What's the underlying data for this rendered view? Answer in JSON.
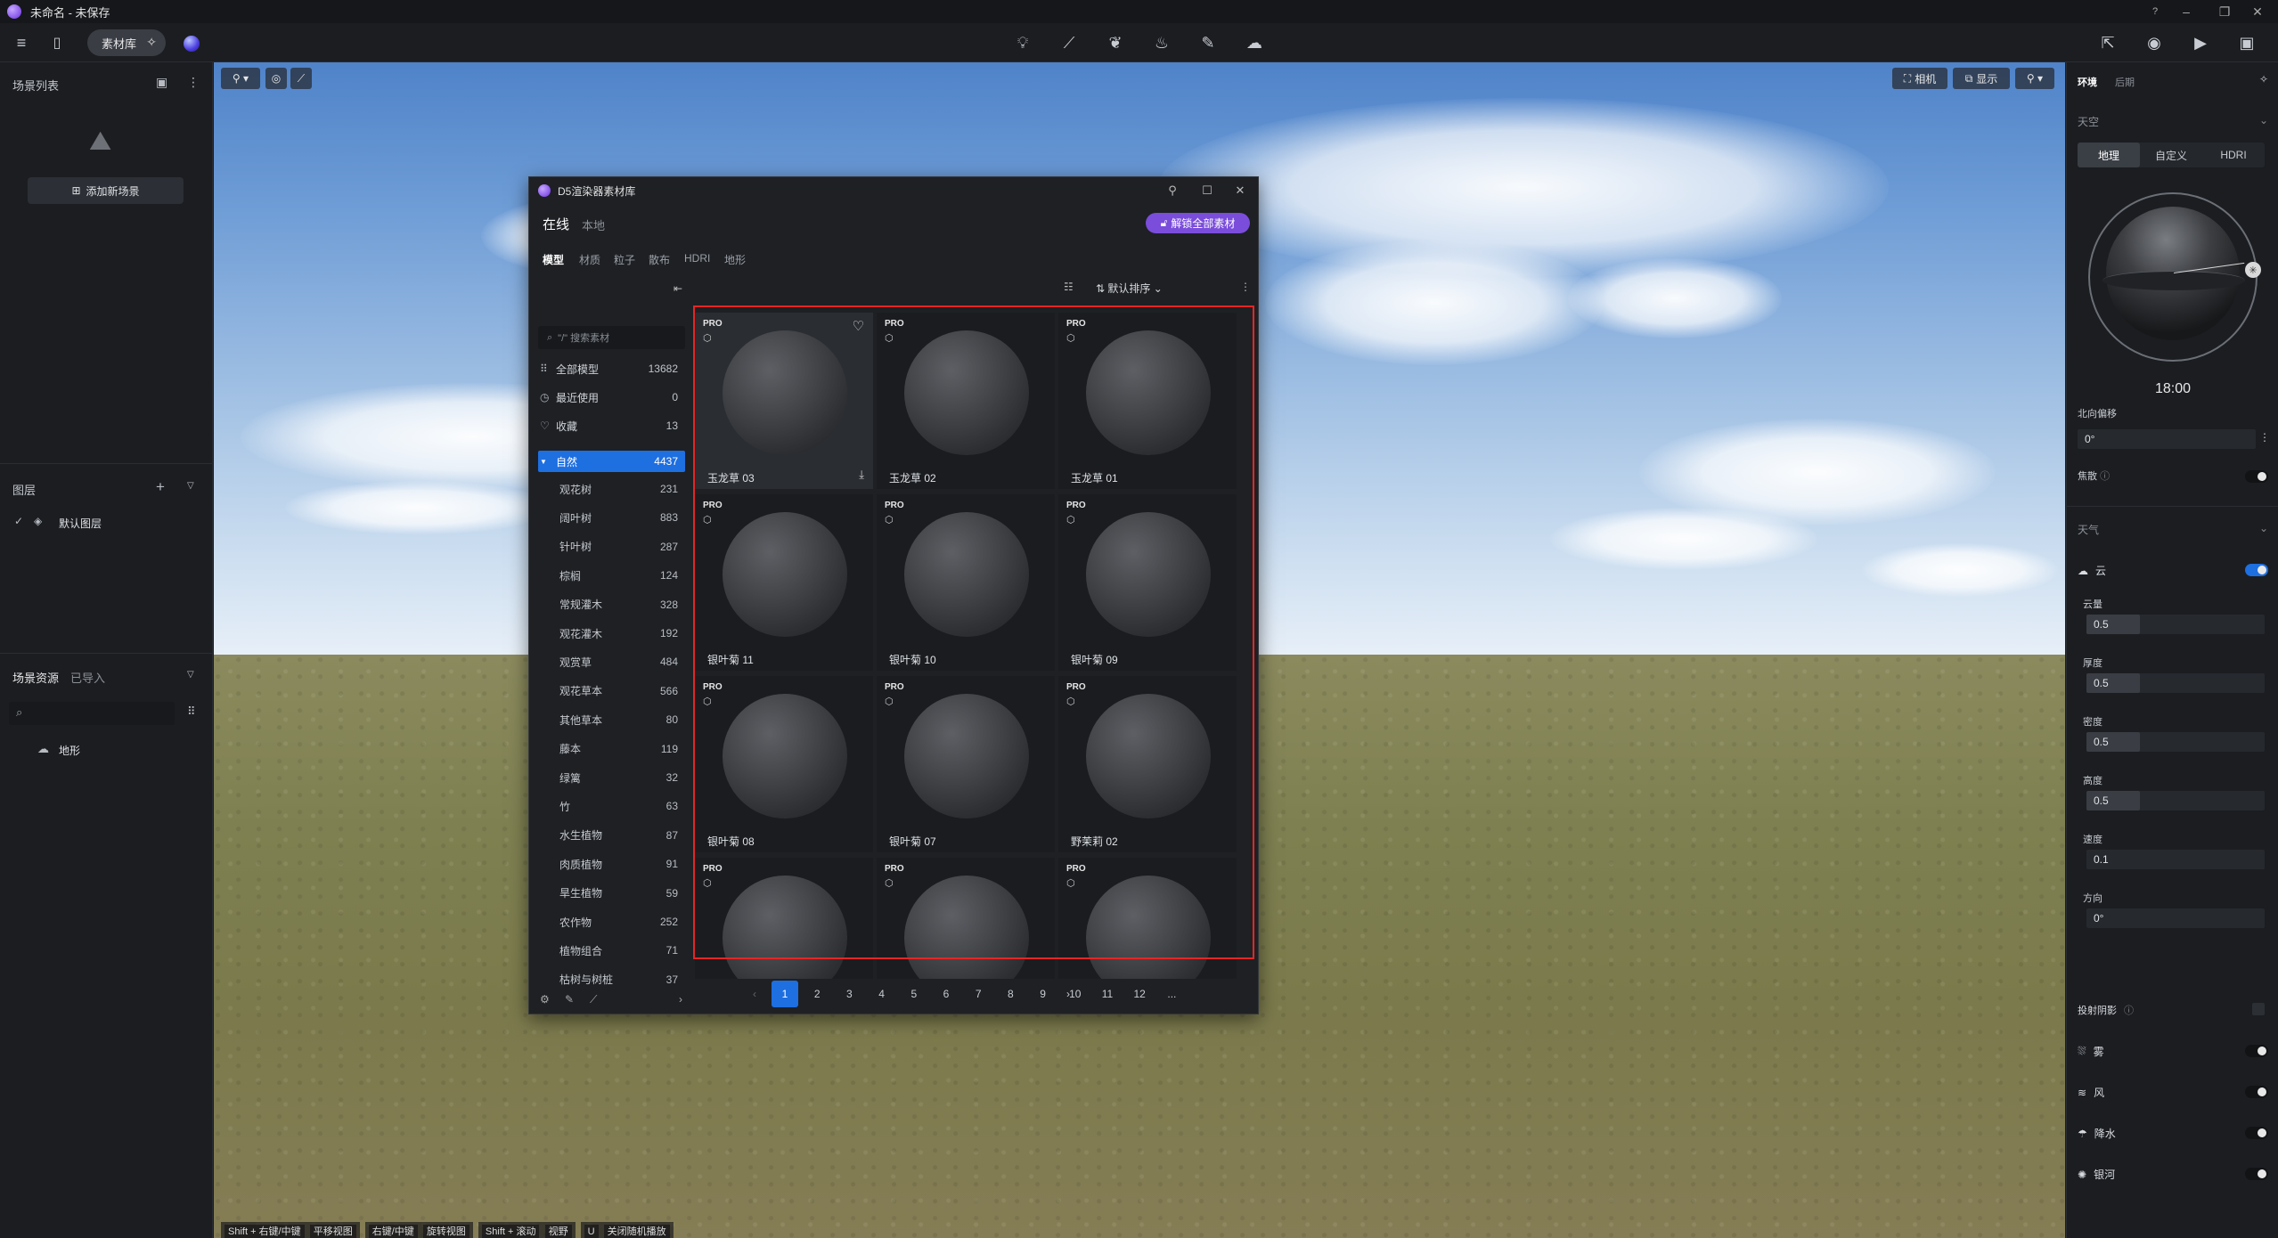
{
  "app": {
    "title": "未命名 - 未保存"
  },
  "toolbar": {
    "library_label": "素材库"
  },
  "left": {
    "scene_list_label": "场景列表",
    "add_scene_label": "添加新场景",
    "layers_label": "图层",
    "default_layer": "默认图层",
    "scene_assets_label": "场景资源",
    "imported_label": "已导入",
    "terrain_label": "地形"
  },
  "viewport": {
    "camera_label": "相机",
    "display_label": "显示",
    "hints": [
      "Shift + 右键/中键",
      "平移视图",
      "右键/中键",
      "旋转视图",
      "Shift + 滚动",
      "视野",
      "U",
      "关闭随机播放"
    ]
  },
  "library": {
    "title": "D5渲染器素材库",
    "online": "在线",
    "local": "本地",
    "unlock": "解锁全部素材",
    "tabs": [
      "模型",
      "材质",
      "粒子",
      "散布",
      "HDRI",
      "地形"
    ],
    "search_placeholder": "\"/\" 搜索素材",
    "sort_label": "默认排序",
    "top_cats": [
      {
        "label": "全部模型",
        "count": "13682",
        "icon": "grid-icon"
      },
      {
        "label": "最近使用",
        "count": "0",
        "icon": "history-icon"
      },
      {
        "label": "收藏",
        "count": "13",
        "icon": "heart-icon"
      }
    ],
    "nature": {
      "label": "自然",
      "count": "4437"
    },
    "subcats": [
      {
        "label": "观花树",
        "count": "231"
      },
      {
        "label": "阔叶树",
        "count": "883"
      },
      {
        "label": "针叶树",
        "count": "287"
      },
      {
        "label": "棕榈",
        "count": "124"
      },
      {
        "label": "常规灌木",
        "count": "328"
      },
      {
        "label": "观花灌木",
        "count": "192"
      },
      {
        "label": "观赏草",
        "count": "484"
      },
      {
        "label": "观花草本",
        "count": "566"
      },
      {
        "label": "其他草本",
        "count": "80"
      },
      {
        "label": "藤本",
        "count": "119"
      },
      {
        "label": "绿篱",
        "count": "32"
      },
      {
        "label": "竹",
        "count": "63"
      },
      {
        "label": "水生植物",
        "count": "87"
      },
      {
        "label": "肉质植物",
        "count": "91"
      },
      {
        "label": "旱生植物",
        "count": "59"
      },
      {
        "label": "农作物",
        "count": "252"
      },
      {
        "label": "植物组合",
        "count": "71"
      },
      {
        "label": "枯树与树桩",
        "count": "37"
      }
    ],
    "badge": "PRO",
    "items": [
      "玉龙草 03",
      "玉龙草 02",
      "玉龙草 01",
      "银叶菊 11",
      "银叶菊 10",
      "银叶菊 09",
      "银叶菊 08",
      "银叶菊 07",
      "野茉莉 02",
      "",
      "",
      ""
    ],
    "pages": [
      "1",
      "2",
      "3",
      "4",
      "5",
      "6",
      "7",
      "8",
      "9",
      "10",
      "11",
      "12",
      "..."
    ],
    "current_page": "1"
  },
  "right": {
    "tab_env": "环境",
    "tab_post": "后期",
    "sky_label": "天空",
    "sky_modes": [
      "地理",
      "自定义",
      "HDRI"
    ],
    "time": "18:00",
    "north_offset_label": "北向偏移",
    "north_offset_value": "0°",
    "focal_label": "焦散",
    "weather_label": "天气",
    "cloud_label": "云",
    "sliders": [
      {
        "label": "云量",
        "value": "0.5",
        "fill": 0.3
      },
      {
        "label": "厚度",
        "value": "0.5",
        "fill": 0.3
      },
      {
        "label": "密度",
        "value": "0.5",
        "fill": 0.3
      },
      {
        "label": "高度",
        "value": "0.5",
        "fill": 0.3
      },
      {
        "label": "速度",
        "value": "0.1",
        "fill": 0
      },
      {
        "label": "方向",
        "value": "0°",
        "fill": 0
      }
    ],
    "cast_shadow_label": "投射阴影",
    "fog_label": "雾",
    "wind_label": "风",
    "rain_label": "降水",
    "galaxy_label": "银河"
  },
  "colors": {
    "accent": "#1e6fe0",
    "pro_purple": "#7a4ddb",
    "highlight": "#e52525"
  }
}
